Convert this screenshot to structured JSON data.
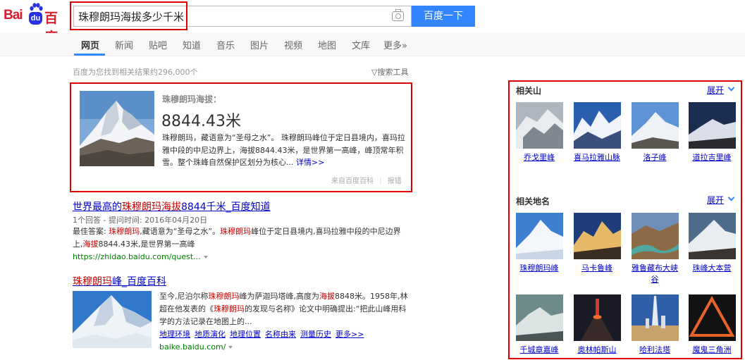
{
  "header": {
    "logo": {
      "left_text": "Bai",
      "badge": "du",
      "right_text": "百度"
    },
    "search_value": "珠穆朗玛海拔多少千米",
    "search_button": "百度一下"
  },
  "nav": {
    "tabs": [
      "网页",
      "新闻",
      "贴吧",
      "知道",
      "音乐",
      "图片",
      "视频",
      "地图",
      "文库",
      "更多»"
    ]
  },
  "result_count": "百度为您找到相关结果约296,000个",
  "search_tools": "搜索工具",
  "answer": {
    "label": "珠穆朗玛海拔：",
    "value": "8844.43米",
    "description": "珠穆朗玛，藏语意为“圣母之水”。 珠穆朗玛峰位于定日县境内，喜玛拉雅中段的中尼边界上，海拔8844.43米，是世界第一高峰，峰顶常年积雪。整个珠峰自然保护区划分为核心...",
    "more": "详情>>",
    "source": "来自百度百科",
    "report": "报错"
  },
  "results": [
    {
      "title_parts": [
        "世界最高的",
        "珠穆朗玛海拔",
        "8844千米",
        "_百度知道"
      ],
      "meta": "1个回答 - 提问时间: 2016年04月20日",
      "snippet_parts": [
        "最佳答案: ",
        "珠穆朗玛",
        ",藏语意为“圣母之水”。",
        "珠穆朗玛",
        "峰位于定日县境内,喜玛拉雅中段的中尼边界上,",
        "海拔",
        "8844.43米,是世界第一高峰"
      ],
      "url": "https://zhidao.baidu.com/quest..."
    },
    {
      "title_parts": [
        "珠穆朗玛",
        "峰_百度百科"
      ],
      "snippet_parts": [
        "至今,尼泊尔称",
        "珠穆朗玛",
        "峰为萨迦玛塔峰,高度为",
        "海拔",
        "8848米。1958年,林超在他发表的《",
        "珠穆朗玛",
        "的发现与名称》论文中明确提出:“把此山峰用科学的方法记录在地图上的..."
      ],
      "links": [
        "地理环境",
        "地质演化",
        "地理位置",
        "名称由来",
        "测量历史",
        "更多>>"
      ],
      "url": "baike.baidu.com/"
    }
  ],
  "right_panel": {
    "sections": [
      {
        "title": "相关山",
        "expand": "展开",
        "items": [
          "乔戈里峰",
          "喜马拉雅山脉",
          "洛子峰",
          "道拉吉里峰"
        ]
      },
      {
        "title": "相关地名",
        "expand": "展开",
        "items": [
          "珠穆朗玛峰",
          "马卡鲁峰",
          "雅鲁藏布大峡谷",
          "珠峰大本营",
          "千城章嘉峰",
          "奥林帕斯山",
          "哈利法塔",
          "魔鬼三角洲"
        ]
      }
    ]
  }
}
